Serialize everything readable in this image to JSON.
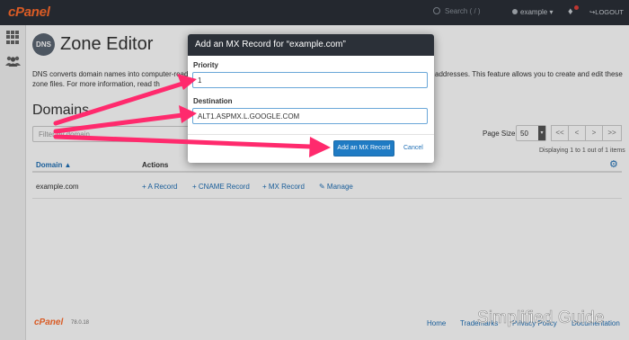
{
  "topbar": {
    "logo": "cPanel",
    "search_placeholder": "Search ( / )",
    "user": "example",
    "logout": "LOGOUT"
  },
  "page": {
    "badge": "DNS",
    "title": "Zone Editor",
    "description_line1_left": "DNS converts domain names into computer-read",
    "description_line1_right": "addresses. This feature allows you to create and edit these",
    "description_line2": "zone files. For more information, read th"
  },
  "domains": {
    "heading": "Domains",
    "filter_placeholder": "Filter by domain",
    "page_size_label": "Page Size",
    "page_size_value": "50",
    "pager": [
      "<<",
      "<",
      ">",
      ">>"
    ],
    "displaying": "Displaying 1 to 1 out of 1 items",
    "columns": [
      "Domain ▲",
      "Actions"
    ],
    "rows": [
      {
        "domain": "example.com",
        "actions": [
          "+ A Record",
          "+ CNAME Record",
          "+ MX Record",
          "✎ Manage"
        ]
      }
    ]
  },
  "modal": {
    "title": "Add an MX Record for “example.com”",
    "priority_label": "Priority",
    "priority_value": "1",
    "destination_label": "Destination",
    "destination_value": "ALT1.ASPMX.L.GOOGLE.COM",
    "submit_label": "Add an MX Record",
    "cancel_label": "Cancel"
  },
  "footer": {
    "logo": "cPanel",
    "version": "78.0.18",
    "links": [
      "Home",
      "Trademarks",
      "Privacy Policy",
      "Documentation"
    ]
  },
  "watermark": "Simplified Guide",
  "colors": {
    "topbar": "#2b3038",
    "accent": "#1f7bc4",
    "brand": "#ff6c2c",
    "arrow": "#ff2a6d"
  }
}
